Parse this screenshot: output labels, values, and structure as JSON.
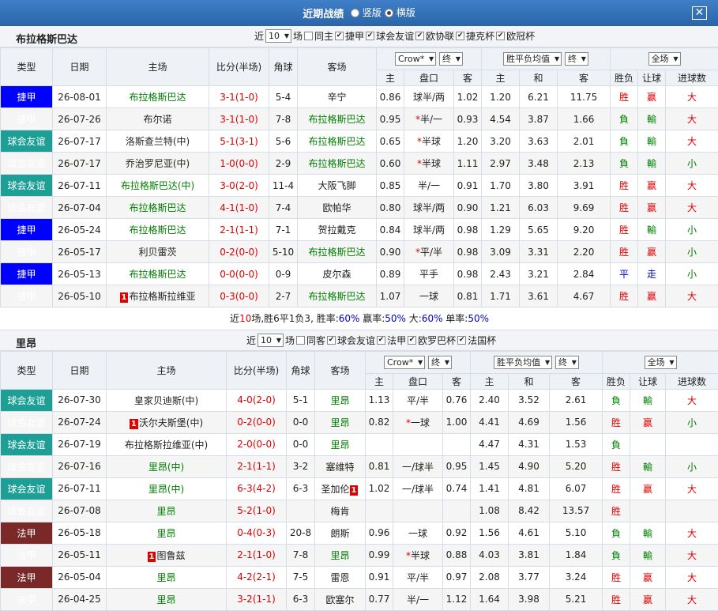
{
  "header": {
    "title": "近期战绩",
    "opt1": "竖版",
    "opt2": "横版",
    "close": "✕"
  },
  "sec1": {
    "team": "布拉格斯巴达",
    "recent_label": "近",
    "count": "10",
    "unit": "场",
    "filters": [
      "同主",
      "捷甲",
      "球会友谊",
      "欧协联",
      "捷克杯",
      "欧冠杯"
    ],
    "sel1": "Crow*",
    "sel2": "终",
    "sel3": "胜平负均值",
    "sel4": "终",
    "sel5": "全场",
    "summary": {
      "p1": "近",
      "n": "10",
      "p2": "场,胜6平1负3, 胜率:",
      "win": "60%",
      "p3": " 赢率:",
      "ying": "50%",
      "p4": " 大:",
      "da": "60%",
      "p5": " 单率:",
      "dan": "50%"
    }
  },
  "sec2": {
    "team": "里昂",
    "recent_label": "近",
    "count": "10",
    "unit": "场",
    "filters": [
      "同客",
      "球会友谊",
      "法甲",
      "欧罗巴杯",
      "法国杯"
    ],
    "sel1": "Crow*",
    "sel2": "终",
    "sel3": "胜平负均值",
    "sel4": "终",
    "sel5": "全场"
  },
  "cols": {
    "type": "类型",
    "date": "日期",
    "home": "主场",
    "score": "比分(半场)",
    "corner": "角球",
    "away": "客场",
    "sub_home": "主",
    "sub_pan": "盘口",
    "sub_away": "客",
    "sub_h": "主",
    "sub_d": "和",
    "sub_a": "客",
    "res": "胜负",
    "hcp": "让球",
    "goals": "进球数"
  },
  "rows1": [
    {
      "type": "捷甲",
      "tc": "blue",
      "date": "26-08-01",
      "home": "布拉格斯巴达",
      "hc": "green",
      "score": "3-1(1-0)",
      "corner": "5-4",
      "away": "辛宁",
      "ac": "",
      "o1": "0.86",
      "pan": "球半/两",
      "o2": "1.02",
      "e1": "1.20",
      "e2": "6.21",
      "e3": "11.75",
      "res": "胜",
      "rc": "red",
      "hcp": "赢",
      "hc2": "red",
      "gl": "大",
      "gc": "red"
    },
    {
      "type": "捷甲",
      "tc": "blue",
      "date": "26-07-26",
      "home": "布尔诺",
      "hc": "",
      "score": "3-1(1-0)",
      "corner": "7-8",
      "away": "布拉格斯巴达",
      "ac": "green",
      "o1": "0.95",
      "pan": "*半/一",
      "o2": "0.93",
      "e1": "4.54",
      "e2": "3.87",
      "e3": "1.66",
      "res": "負",
      "rc": "green",
      "hcp": "輸",
      "hc2": "green",
      "gl": "大",
      "gc": "red"
    },
    {
      "type": "球会友谊",
      "tc": "teal",
      "date": "26-07-17",
      "home": "洛斯查兰特(中)",
      "hc": "",
      "score": "5-1(3-1)",
      "corner": "5-6",
      "away": "布拉格斯巴达",
      "ac": "green",
      "o1": "0.65",
      "pan": "*半球",
      "o2": "1.20",
      "e1": "3.20",
      "e2": "3.63",
      "e3": "2.01",
      "res": "負",
      "rc": "green",
      "hcp": "輸",
      "hc2": "green",
      "gl": "大",
      "gc": "red"
    },
    {
      "type": "球会友谊",
      "tc": "teal",
      "date": "26-07-17",
      "home": "乔治罗尼亚(中)",
      "hc": "",
      "score": "1-0(0-0)",
      "corner": "2-9",
      "away": "布拉格斯巴达",
      "ac": "green",
      "o1": "0.60",
      "pan": "*半球",
      "o2": "1.11",
      "e1": "2.97",
      "e2": "3.48",
      "e3": "2.13",
      "res": "負",
      "rc": "green",
      "hcp": "輸",
      "hc2": "green",
      "gl": "小",
      "gc": "green"
    },
    {
      "type": "球会友谊",
      "tc": "teal",
      "date": "26-07-11",
      "home": "布拉格斯巴达(中)",
      "hc": "green",
      "score": "3-0(2-0)",
      "corner": "11-4",
      "away": "大阪飞脚",
      "ac": "",
      "o1": "0.85",
      "pan": "半/一",
      "o2": "0.91",
      "e1": "1.70",
      "e2": "3.80",
      "e3": "3.91",
      "res": "胜",
      "rc": "red",
      "hcp": "赢",
      "hc2": "red",
      "gl": "大",
      "gc": "red"
    },
    {
      "type": "球会友谊",
      "tc": "teal",
      "date": "26-07-04",
      "home": "布拉格斯巴达",
      "hc": "green",
      "score": "4-1(1-0)",
      "corner": "7-4",
      "away": "欧帕华",
      "ac": "",
      "o1": "0.80",
      "pan": "球半/两",
      "o2": "0.90",
      "e1": "1.21",
      "e2": "6.03",
      "e3": "9.69",
      "res": "胜",
      "rc": "red",
      "hcp": "赢",
      "hc2": "red",
      "gl": "大",
      "gc": "red"
    },
    {
      "type": "捷甲",
      "tc": "blue",
      "date": "26-05-24",
      "home": "布拉格斯巴达",
      "hc": "green",
      "score": "2-1(1-1)",
      "corner": "7-1",
      "away": "贺拉戴克",
      "ac": "",
      "o1": "0.84",
      "pan": "球半/两",
      "o2": "0.98",
      "e1": "1.29",
      "e2": "5.65",
      "e3": "9.20",
      "res": "胜",
      "rc": "red",
      "hcp": "輸",
      "hc2": "green",
      "gl": "小",
      "gc": "green"
    },
    {
      "type": "捷甲",
      "tc": "blue",
      "date": "26-05-17",
      "home": "利贝雷茨",
      "hc": "",
      "score": "0-2(0-0)",
      "corner": "5-10",
      "away": "布拉格斯巴达",
      "ac": "green",
      "o1": "0.90",
      "pan": "*平/半",
      "o2": "0.98",
      "e1": "3.09",
      "e2": "3.31",
      "e3": "2.20",
      "res": "胜",
      "rc": "red",
      "hcp": "赢",
      "hc2": "red",
      "gl": "小",
      "gc": "green"
    },
    {
      "type": "捷甲",
      "tc": "blue",
      "date": "26-05-13",
      "home": "布拉格斯巴达",
      "hc": "green",
      "score": "0-0(0-0)",
      "corner": "0-9",
      "away": "皮尔森",
      "ac": "",
      "o1": "0.89",
      "pan": "平手",
      "o2": "0.98",
      "e1": "2.43",
      "e2": "3.21",
      "e3": "2.84",
      "res": "平",
      "rc": "blue",
      "hcp": "走",
      "hc2": "blue",
      "gl": "小",
      "gc": "green"
    },
    {
      "type": "捷甲",
      "tc": "blue",
      "date": "26-05-10",
      "home": "布拉格斯拉维亚",
      "hc": "",
      "hrc": "1",
      "score": "0-3(0-0)",
      "corner": "2-7",
      "away": "布拉格斯巴达",
      "ac": "green",
      "o1": "1.07",
      "pan": "一球",
      "o2": "0.81",
      "e1": "1.71",
      "e2": "3.61",
      "e3": "4.67",
      "res": "胜",
      "rc": "red",
      "hcp": "赢",
      "hc2": "red",
      "gl": "大",
      "gc": "red"
    }
  ],
  "rows2": [
    {
      "type": "球会友谊",
      "tc": "teal",
      "date": "26-07-30",
      "home": "皇家贝迪斯(中)",
      "hc": "",
      "score": "4-0(2-0)",
      "corner": "5-1",
      "away": "里昂",
      "ac": "green",
      "o1": "1.13",
      "pan": "平/半",
      "o2": "0.76",
      "e1": "2.40",
      "e2": "3.52",
      "e3": "2.61",
      "res": "負",
      "rc": "green",
      "hcp": "輸",
      "hc2": "green",
      "gl": "大",
      "gc": "red"
    },
    {
      "type": "球会友谊",
      "tc": "teal",
      "date": "26-07-24",
      "home": "沃尔夫斯堡(中)",
      "hc": "",
      "hrc": "1",
      "score": "0-2(0-0)",
      "corner": "0-0",
      "away": "里昂",
      "ac": "green",
      "o1": "0.82",
      "pan": "*一球",
      "o2": "1.00",
      "e1": "4.41",
      "e2": "4.69",
      "e3": "1.56",
      "res": "胜",
      "rc": "red",
      "hcp": "赢",
      "hc2": "red",
      "gl": "小",
      "gc": "green"
    },
    {
      "type": "球会友谊",
      "tc": "teal",
      "date": "26-07-19",
      "home": "布拉格斯拉维亚(中)",
      "hc": "",
      "score": "2-0(0-0)",
      "corner": "0-0",
      "away": "里昂",
      "ac": "green",
      "o1": "",
      "pan": "",
      "o2": "",
      "e1": "4.47",
      "e2": "4.31",
      "e3": "1.53",
      "res": "負",
      "rc": "green",
      "hcp": "",
      "hc2": "",
      "gl": "",
      "gc": ""
    },
    {
      "type": "球会友谊",
      "tc": "teal",
      "date": "26-07-16",
      "home": "里昂(中)",
      "hc": "green",
      "score": "2-1(1-1)",
      "corner": "3-2",
      "away": "塞维特",
      "ac": "",
      "o1": "0.81",
      "pan": "一/球半",
      "o2": "0.95",
      "e1": "1.45",
      "e2": "4.90",
      "e3": "5.20",
      "res": "胜",
      "rc": "red",
      "hcp": "輸",
      "hc2": "green",
      "gl": "小",
      "gc": "green"
    },
    {
      "type": "球会友谊",
      "tc": "teal",
      "date": "26-07-11",
      "home": "里昂(中)",
      "hc": "green",
      "score": "6-3(4-2)",
      "corner": "6-3",
      "away": "圣加伦",
      "ac": "",
      "arc": "1",
      "o1": "1.02",
      "pan": "一/球半",
      "o2": "0.74",
      "e1": "1.41",
      "e2": "4.81",
      "e3": "6.07",
      "res": "胜",
      "rc": "red",
      "hcp": "赢",
      "hc2": "red",
      "gl": "大",
      "gc": "red"
    },
    {
      "type": "球会友谊",
      "tc": "teal",
      "date": "26-07-08",
      "home": "里昂",
      "hc": "green",
      "score": "5-2(1-0)",
      "corner": "",
      "away": "梅肯",
      "ac": "",
      "o1": "",
      "pan": "",
      "o2": "",
      "e1": "1.08",
      "e2": "8.42",
      "e3": "13.57",
      "res": "胜",
      "rc": "red",
      "hcp": "",
      "hc2": "",
      "gl": "",
      "gc": ""
    },
    {
      "type": "法甲",
      "tc": "brown",
      "date": "26-05-18",
      "home": "里昂",
      "hc": "green",
      "score": "0-4(0-3)",
      "corner": "20-8",
      "away": "朗斯",
      "ac": "",
      "o1": "0.96",
      "pan": "一球",
      "o2": "0.92",
      "e1": "1.56",
      "e2": "4.61",
      "e3": "5.10",
      "res": "負",
      "rc": "green",
      "hcp": "輸",
      "hc2": "green",
      "gl": "大",
      "gc": "red"
    },
    {
      "type": "法甲",
      "tc": "brown",
      "date": "26-05-11",
      "home": "图鲁兹",
      "hc": "",
      "hrc": "1",
      "score": "2-1(1-0)",
      "corner": "7-8",
      "away": "里昂",
      "ac": "green",
      "o1": "0.99",
      "pan": "*半球",
      "o2": "0.88",
      "e1": "4.03",
      "e2": "3.81",
      "e3": "1.84",
      "res": "負",
      "rc": "green",
      "hcp": "輸",
      "hc2": "green",
      "gl": "大",
      "gc": "red"
    },
    {
      "type": "法甲",
      "tc": "brown",
      "date": "26-05-04",
      "home": "里昂",
      "hc": "green",
      "score": "4-2(2-1)",
      "corner": "7-5",
      "away": "雷恩",
      "ac": "",
      "o1": "0.91",
      "pan": "平/半",
      "o2": "0.97",
      "e1": "2.08",
      "e2": "3.77",
      "e3": "3.24",
      "res": "胜",
      "rc": "red",
      "hcp": "赢",
      "hc2": "red",
      "gl": "大",
      "gc": "red"
    },
    {
      "type": "法甲",
      "tc": "brown",
      "date": "26-04-25",
      "home": "里昂",
      "hc": "green",
      "score": "3-2(1-1)",
      "corner": "6-3",
      "away": "欧塞尔",
      "ac": "",
      "o1": "0.77",
      "pan": "半/一",
      "o2": "1.12",
      "e1": "1.64",
      "e2": "3.98",
      "e3": "5.21",
      "res": "胜",
      "rc": "red",
      "hcp": "赢",
      "hc2": "red",
      "gl": "大",
      "gc": "red"
    }
  ]
}
